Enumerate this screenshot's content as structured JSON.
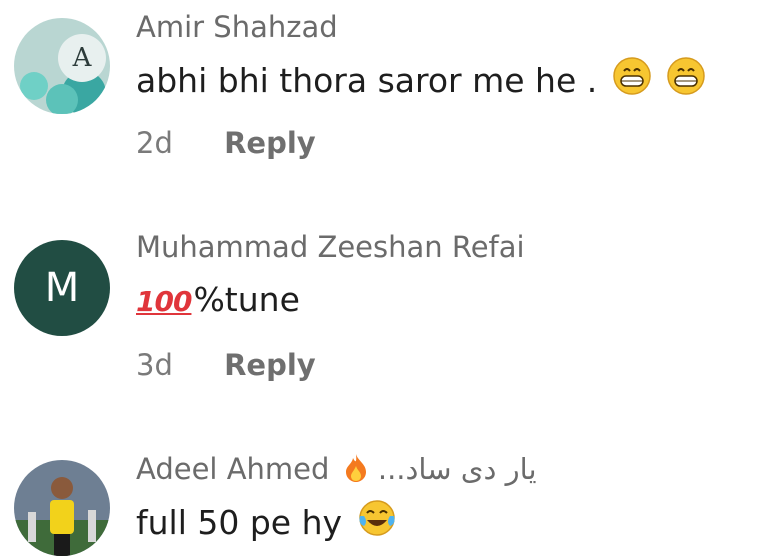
{
  "comments": [
    {
      "author": "Amir Shahzad",
      "avatar_letter": "A",
      "text": "abhi bhi thora saror me he .",
      "emoji": [
        "grinning-face-icon",
        "grinning-face-icon"
      ],
      "age": "2d",
      "reply_label": "Reply"
    },
    {
      "author": "Muhammad Zeeshan Refai",
      "avatar_letter": "M",
      "badge_text": "100",
      "text": "%tune",
      "age": "3d",
      "reply_label": "Reply"
    },
    {
      "author": "Adeel Ahmed",
      "author_suffix": "یار دی ساد...",
      "text": "full 50 pe hy",
      "emoji": [
        "tears-of-joy-icon"
      ]
    }
  ],
  "colors": {
    "avatar_m_bg": "#214d43",
    "meta_gray": "#7a7a7a",
    "name_gray": "#6b6b6b",
    "accent_red": "#e0353b"
  }
}
